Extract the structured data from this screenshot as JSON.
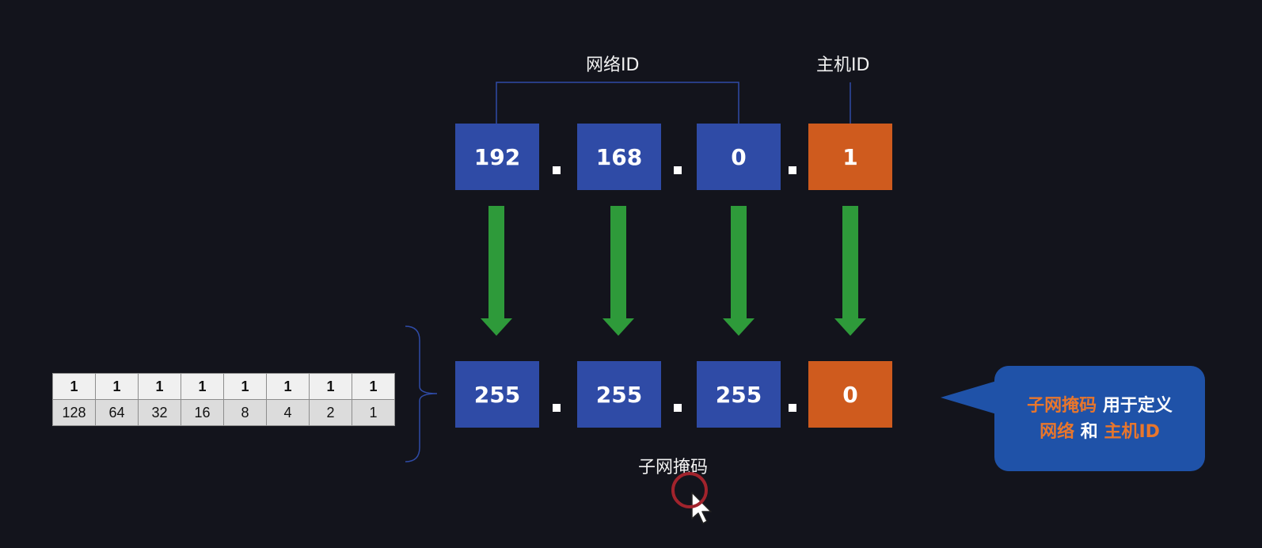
{
  "labels": {
    "network_id": "网络ID",
    "host_id": "主机ID",
    "subnet_mask": "子网掩码"
  },
  "ip_octets": [
    "192",
    "168",
    "0",
    "1"
  ],
  "mask_octets": [
    "255",
    "255",
    "255",
    "0"
  ],
  "bit_table": {
    "bits": [
      "1",
      "1",
      "1",
      "1",
      "1",
      "1",
      "1",
      "1"
    ],
    "weights": [
      "128",
      "64",
      "32",
      "16",
      "8",
      "4",
      "2",
      "1"
    ]
  },
  "callout": {
    "line1_highlight": "子网掩码",
    "line1_rest": " 用于定义",
    "line2_highlight_a": "网络",
    "line2_mid": " 和 ",
    "line2_highlight_b": "主机ID"
  },
  "colors": {
    "network_box": "#2f4ba6",
    "host_box": "#cf5b1e",
    "arrow": "#2e9a3a",
    "callout_bg": "#1f52a8",
    "highlight_text": "#e8762c"
  }
}
